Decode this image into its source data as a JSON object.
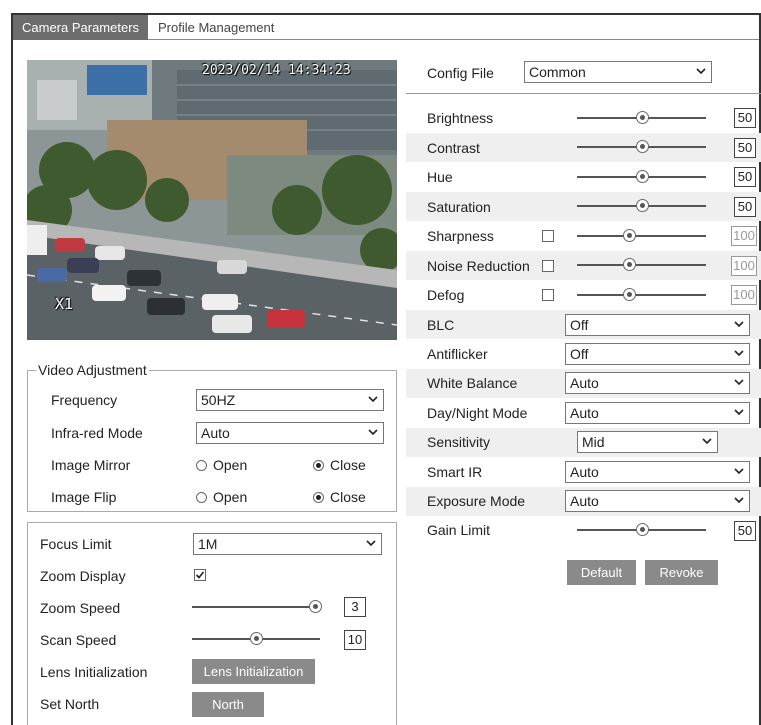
{
  "tabs": [
    {
      "label": "Camera Parameters",
      "active": true
    },
    {
      "label": "Profile Management",
      "active": false
    }
  ],
  "preview": {
    "timestamp": "2023/02/14 14:34:23",
    "zoom": "X1"
  },
  "video_adjustment": {
    "legend": "Video Adjustment",
    "frequency": {
      "label": "Frequency",
      "value": "50HZ"
    },
    "infrared_mode": {
      "label": "Infra-red Mode",
      "value": "Auto"
    },
    "image_mirror": {
      "label": "Image Mirror",
      "open": "Open",
      "close": "Close",
      "selected": "Close"
    },
    "image_flip": {
      "label": "Image Flip",
      "open": "Open",
      "close": "Close",
      "selected": "Close"
    }
  },
  "lens": {
    "focus_limit": {
      "label": "Focus Limit",
      "value": "1M"
    },
    "zoom_display": {
      "label": "Zoom Display",
      "checked": true
    },
    "zoom_speed": {
      "label": "Zoom Speed",
      "value": "3",
      "level": 1.0
    },
    "scan_speed": {
      "label": "Scan Speed",
      "value": "10",
      "level": 0.5
    },
    "lens_init": {
      "label": "Lens Initialization",
      "button": "Lens Initialization"
    },
    "set_north": {
      "label": "Set North",
      "button": "North"
    }
  },
  "config_file": {
    "label": "Config File",
    "value": "Common"
  },
  "image": {
    "brightness": {
      "label": "Brightness",
      "value": "50",
      "level": 0.5
    },
    "contrast": {
      "label": "Contrast",
      "value": "50",
      "level": 0.5
    },
    "hue": {
      "label": "Hue",
      "value": "50",
      "level": 0.5
    },
    "saturation": {
      "label": "Saturation",
      "value": "50",
      "level": 0.5
    },
    "sharpness": {
      "label": "Sharpness",
      "value": "100",
      "level": 0.4
    },
    "noise_reduction": {
      "label": "Noise Reduction",
      "value": "100",
      "level": 0.4
    },
    "defog": {
      "label": "Defog",
      "value": "100",
      "level": 0.4
    }
  },
  "selects": {
    "blc": {
      "label": "BLC",
      "value": "Off"
    },
    "antiflicker": {
      "label": "Antiflicker",
      "value": "Off"
    },
    "white_balance": {
      "label": "White Balance",
      "value": "Auto"
    },
    "day_night": {
      "label": "Day/Night Mode",
      "value": "Auto"
    },
    "sensitivity": {
      "label": "Sensitivity",
      "value": "Mid"
    },
    "smart_ir": {
      "label": "Smart IR",
      "value": "Auto"
    },
    "exposure_mode": {
      "label": "Exposure Mode",
      "value": "Auto"
    }
  },
  "gain_limit": {
    "label": "Gain Limit",
    "value": "50",
    "level": 0.5
  },
  "buttons": {
    "default": "Default",
    "revoke": "Revoke"
  }
}
